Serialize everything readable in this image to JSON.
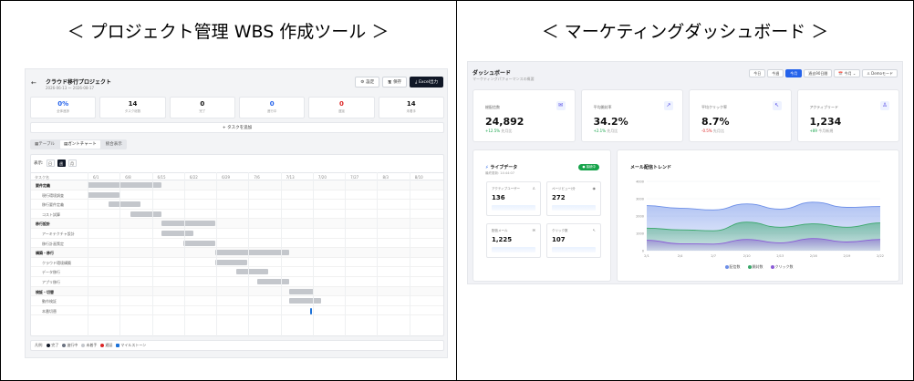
{
  "panels": {
    "left_title": "＜ プロジェクト管理 WBS 作成ツール ＞",
    "right_title": "＜ マーケティングダッシュボード ＞"
  },
  "wbs": {
    "back": "←",
    "title": "クラウド移行プロジェクト",
    "date": "2026-06-13 〜 2026-08-17",
    "buttons": [
      {
        "icon": "⚙",
        "label": "設定"
      },
      {
        "icon": "🖫",
        "label": "保存"
      },
      {
        "icon": "⤓",
        "label": "Excel出力"
      }
    ],
    "stats": [
      {
        "value": "0%",
        "label": "全体進捗",
        "color": "#2563eb"
      },
      {
        "value": "14",
        "label": "タスク総数",
        "color": "#111"
      },
      {
        "value": "0",
        "label": "完了",
        "color": "#111"
      },
      {
        "value": "0",
        "label": "進行中",
        "color": "#2563eb"
      },
      {
        "value": "0",
        "label": "遅延",
        "color": "#dc2626"
      },
      {
        "value": "14",
        "label": "未着手",
        "color": "#111"
      }
    ],
    "add_task": "+ タスクを追加",
    "tabs": [
      {
        "icon": "▦",
        "label": "テーブル"
      },
      {
        "icon": "▤",
        "label": "ガントチャート"
      },
      {
        "icon": "",
        "label": "統合表示"
      }
    ],
    "view_label": "表示:",
    "views": [
      "日",
      "週",
      "月"
    ],
    "task_col": "タスク名",
    "dates": [
      "6/1",
      "6/8",
      "6/15",
      "6/22",
      "6/29",
      "7/6",
      "7/13",
      "7/20",
      "7/27",
      "8/3",
      "8/10"
    ],
    "rows": [
      {
        "name": "要件定義",
        "type": "phase",
        "s": 0.0,
        "e": 0.21
      },
      {
        "name": "現行環境調査",
        "type": "task",
        "s": 0.0,
        "e": 0.09
      },
      {
        "name": "移行要件定義",
        "type": "task",
        "s": 0.06,
        "e": 0.15
      },
      {
        "name": "コスト試算",
        "type": "task",
        "s": 0.12,
        "e": 0.21
      },
      {
        "name": "移行設計",
        "type": "phase",
        "s": 0.21,
        "e": 0.36
      },
      {
        "name": "アーキテクチャ設計",
        "type": "task",
        "s": 0.21,
        "e": 0.3
      },
      {
        "name": "移行計画策定",
        "type": "task",
        "s": 0.27,
        "e": 0.36
      },
      {
        "name": "構築・移行",
        "type": "phase",
        "s": 0.36,
        "e": 0.57
      },
      {
        "name": "クラウド環境構築",
        "type": "task",
        "s": 0.36,
        "e": 0.45
      },
      {
        "name": "データ移行",
        "type": "task",
        "s": 0.42,
        "e": 0.51
      },
      {
        "name": "アプリ移行",
        "type": "task",
        "s": 0.48,
        "e": 0.57
      },
      {
        "name": "検証・切替",
        "type": "phase",
        "s": 0.57,
        "e": 0.64
      },
      {
        "name": "動作検証",
        "type": "task",
        "s": 0.57,
        "e": 0.66
      },
      {
        "name": "本番切替",
        "type": "ms",
        "s": 0.63,
        "e": 0.64
      }
    ],
    "legend_label": "凡例:",
    "legend": [
      {
        "label": "完了",
        "color": "#111827"
      },
      {
        "label": "進行中",
        "color": "#6b7280"
      },
      {
        "label": "未着手",
        "color": "#c4c7cc"
      },
      {
        "label": "遅延",
        "color": "#dc2626"
      },
      {
        "label": "マイルストーン",
        "color": "#1d72d8"
      }
    ]
  },
  "dash": {
    "title": "ダッシュボード",
    "subtitle": "マーケティングパフォーマンスの概要",
    "periods": [
      "今日",
      "今週",
      "今月",
      "過去90日間"
    ],
    "period_active": 2,
    "date_pill": "📅 今月 ⌄",
    "demo": "♙ Demoモード",
    "kpis": [
      {
        "label": "総配信数",
        "value": "24,892",
        "change": "+12.5%",
        "note": "先月比",
        "icon": "✉",
        "up": true
      },
      {
        "label": "平均開封率",
        "value": "34.2%",
        "change": "+2.1%",
        "note": "先月比",
        "icon": "↗",
        "up": true
      },
      {
        "label": "平均クリック率",
        "value": "8.7%",
        "change": "-0.5%",
        "note": "先月比",
        "icon": "↖",
        "up": false
      },
      {
        "label": "アクティブリード",
        "value": "1,234",
        "change": "+89",
        "note": "今月新規",
        "icon": "♙",
        "up": true
      }
    ],
    "live": {
      "title": "ライブデータ",
      "subtitle": "最終更新: 14:44:07",
      "badge": "● 接続中",
      "refresh": "↻",
      "metrics": [
        {
          "label": "アクティブユーザー",
          "value": "136",
          "icon": "♙"
        },
        {
          "label": "ページビュー/分",
          "value": "272",
          "icon": "◉"
        },
        {
          "label": "配信メール",
          "value": "1,225",
          "icon": "✉"
        },
        {
          "label": "クリック数",
          "value": "107",
          "icon": "↖"
        }
      ]
    },
    "trend": {
      "title": "メール配信トレンド"
    }
  },
  "chart_data": {
    "type": "area",
    "title": "メール配信トレンド",
    "x": [
      "2/1",
      "2/4",
      "2/7",
      "2/10",
      "2/13",
      "2/16",
      "2/19",
      "2/22"
    ],
    "ylim": [
      0,
      4000
    ],
    "yticks": [
      0,
      1000,
      2000,
      3000,
      4000
    ],
    "series": [
      {
        "name": "配信数",
        "color": "#6d8fe8",
        "values": [
          2600,
          2450,
          2350,
          2700,
          2400,
          2800,
          2500,
          2550
        ]
      },
      {
        "name": "開封数",
        "color": "#3aa86b",
        "values": [
          1300,
          1200,
          1150,
          1650,
          1350,
          1550,
          1350,
          1600
        ]
      },
      {
        "name": "クリック数",
        "color": "#8b5cd6",
        "values": [
          600,
          400,
          380,
          650,
          450,
          700,
          500,
          650
        ]
      }
    ]
  }
}
